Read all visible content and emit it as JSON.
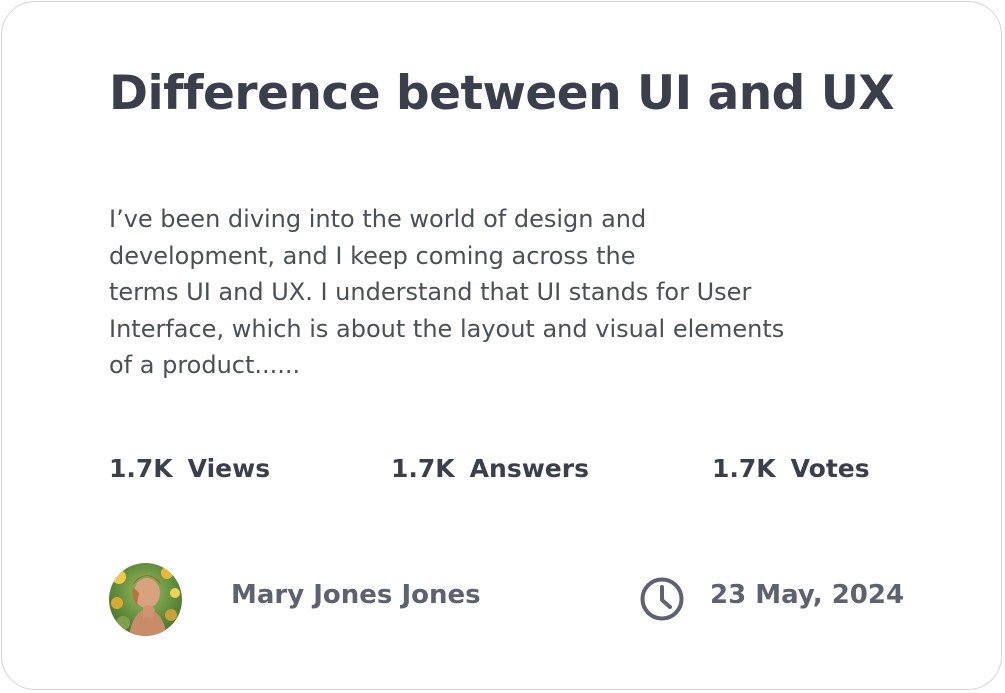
{
  "post": {
    "title": "Difference between UI and UX",
    "excerpt_lines": [
      "I’ve been diving into the world of design and",
      "development, and I keep coming across the",
      "terms UI and UX. I understand that UI stands for User",
      "Interface, which is about the layout and visual elements",
      "of a product......"
    ],
    "stats": {
      "views": {
        "count": "1.7K",
        "label": "Views"
      },
      "answers": {
        "count": "1.7K",
        "label": "Answers"
      },
      "votes": {
        "count": "1.7K",
        "label": "Votes"
      }
    },
    "author": {
      "name": "Mary Jones Jones"
    },
    "date": "23 May, 2024"
  },
  "colors": {
    "title": "#3a3f4b",
    "body": "#4b4f57",
    "meta": "#5d6170",
    "border": "#d3d5da"
  },
  "icons": {
    "date": "clock-icon",
    "author": "avatar-photo"
  }
}
